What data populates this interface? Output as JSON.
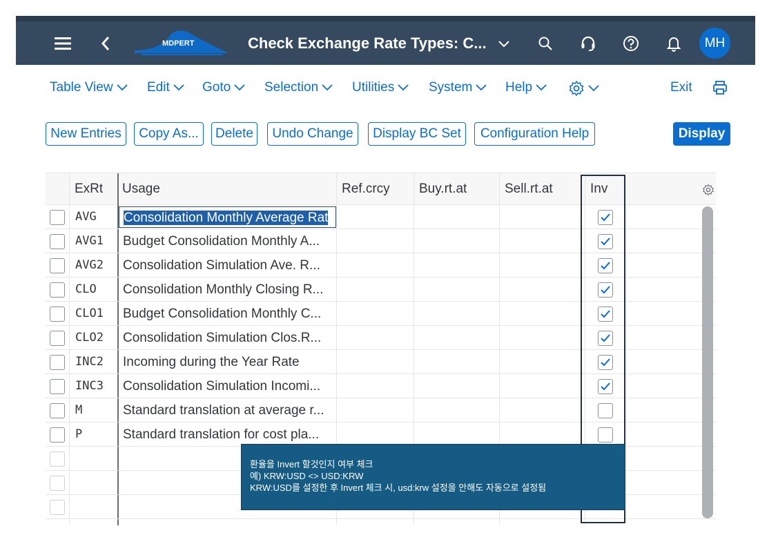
{
  "shell": {
    "title": "Check Exchange Rate Types: C...",
    "logo_text": "MDPERT",
    "avatar_initials": "MH"
  },
  "menu": [
    "Table View",
    "Edit",
    "Goto",
    "Selection",
    "Utilities",
    "System",
    "Help"
  ],
  "menu_right": {
    "exit_label": "Exit"
  },
  "toolbar": {
    "new_entries": "New Entries",
    "copy_as": "Copy As...",
    "delete": "Delete",
    "undo_change": "Undo Change",
    "display_bc_set": "Display BC Set",
    "configuration_help": "Configuration Help",
    "display": "Display"
  },
  "table": {
    "columns": [
      "ExRt",
      "Usage",
      "Ref.crcy",
      "Buy.rt.at",
      "Sell.rt.at",
      "Inv"
    ],
    "rows": [
      {
        "exrt": "AVG",
        "usage": "Consolidation Monthly Average Rat",
        "inv": true
      },
      {
        "exrt": "AVG1",
        "usage": "Budget Consolidation Monthly A...",
        "inv": true
      },
      {
        "exrt": "AVG2",
        "usage": "Consolidation Simulation Ave. R...",
        "inv": true
      },
      {
        "exrt": "CLO",
        "usage": "Consolidation Monthly Closing R...",
        "inv": true
      },
      {
        "exrt": "CLO1",
        "usage": "Budget Consolidation Monthly C...",
        "inv": true
      },
      {
        "exrt": "CLO2",
        "usage": "Consolidation Simulation Clos.R...",
        "inv": true
      },
      {
        "exrt": "INC2",
        "usage": "Incoming during the Year Rate",
        "inv": true
      },
      {
        "exrt": "INC3",
        "usage": "Consolidation Simulation Incomi...",
        "inv": true
      },
      {
        "exrt": "M",
        "usage": "Standard translation at average r...",
        "inv": false
      },
      {
        "exrt": "P",
        "usage": "Standard translation for cost pla...",
        "inv": false
      }
    ]
  },
  "callout": {
    "line1": "환율을 Invert 할것인지 여부 체크",
    "line2": "예) KRW:USD <> USD:KRW",
    "line3": "KRW:USD를 설정한 후 Invert 체크 시, usd:krw 설정을 안해도 자동으로 설정됨"
  },
  "colors": {
    "shell_bg": "#354a5f",
    "accent": "#0a6ed1",
    "callout_bg": "#165b83"
  }
}
